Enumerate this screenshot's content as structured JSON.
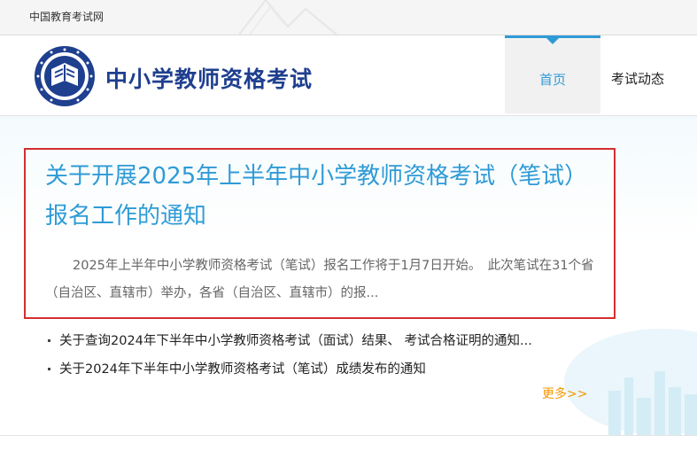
{
  "topbar": {
    "site_name": "中国教育考试网"
  },
  "header": {
    "logo_text": "中小学教师资格考试",
    "nav": [
      {
        "label": "首页",
        "active": true
      },
      {
        "label": "考试动态",
        "active": false
      }
    ]
  },
  "feature": {
    "title": "关于开展2025年上半年中小学教师资格考试（笔试）报名工作的通知",
    "summary": "2025年上半年中小学教师资格考试（笔试）报名工作将于1月7日开始。　此次笔试在31个省（自治区、直辖市）举办，各省（自治区、直辖市）的报..."
  },
  "news": [
    {
      "title": "关于查询2024年下半年中小学教师资格考试（面试）结果、 考试合格证明的通知..."
    },
    {
      "title": "关于2024年下半年中小学教师资格考试（笔试）成绩发布的通知"
    }
  ],
  "more_label": "更多>>",
  "colors": {
    "accent": "#2f9bd6",
    "brand_text": "#1f3f8f",
    "highlight_border": "#d32f2f",
    "more_link": "#f39800"
  },
  "icons": {
    "logo": "ntce-emblem-icon"
  }
}
